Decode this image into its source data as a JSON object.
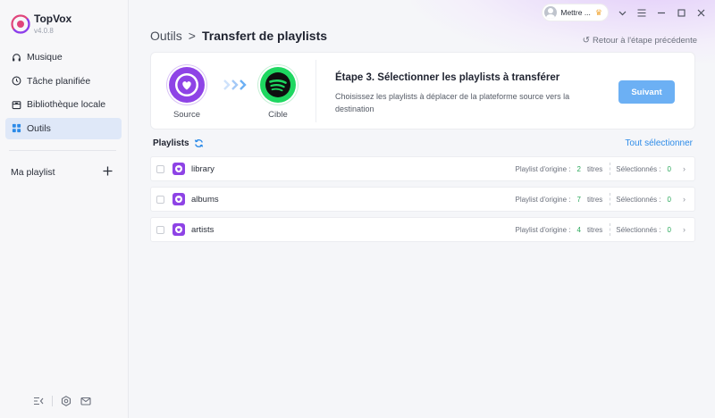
{
  "app": {
    "name": "TopVox",
    "version": "v4.0.8"
  },
  "sidebar": {
    "items": [
      {
        "label": "Musique",
        "icon": "headphones-icon"
      },
      {
        "label": "Tâche planifiée",
        "icon": "clock-icon"
      },
      {
        "label": "Bibliothèque locale",
        "icon": "local-library-icon"
      },
      {
        "label": "Outils",
        "icon": "grid-icon",
        "active": true
      }
    ],
    "my_playlist_label": "Ma playlist",
    "add_playlist_icon": "plus-icon"
  },
  "topbar": {
    "account_label": "Mettre ...",
    "controls": [
      "chevron-down-icon",
      "menu-icon",
      "minimize-icon",
      "maximize-icon",
      "close-icon"
    ]
  },
  "header": {
    "breadcrumb_root": "Outils",
    "breadcrumb_sep": ">",
    "breadcrumb_current": "Transfert de playlists",
    "back_label": "Retour à l'étape précédente"
  },
  "transfer": {
    "source_label": "Source",
    "target_label": "Cible",
    "step_title": "Étape 3. Sélectionner les playlists à transférer",
    "step_description": "Choisissez les playlists à déplacer de la plateforme source vers la destination",
    "next_label": "Suivant"
  },
  "playlists": {
    "header": "Playlists",
    "select_all_label": "Tout sélectionner",
    "origin_label": "Playlist d'origine :",
    "titles_label": "titres",
    "selected_label": "Sélectionnés :",
    "rows": [
      {
        "name": "library",
        "origin_count": "2",
        "selected_count": "0"
      },
      {
        "name": "albums",
        "origin_count": "7",
        "selected_count": "0"
      },
      {
        "name": "artists",
        "origin_count": "4",
        "selected_count": "0"
      }
    ]
  },
  "colors": {
    "accent_blue": "#2d8be8",
    "button_blue": "#6cb0f4",
    "source_purple": "#8e43e6",
    "spotify_green": "#1ed760",
    "count_green": "#2aa85a"
  }
}
